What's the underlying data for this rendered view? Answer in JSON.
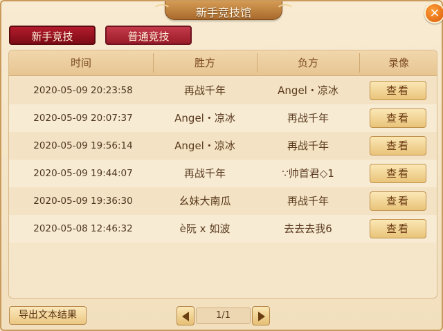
{
  "window": {
    "title": "新手竞技馆",
    "close_icon": "×"
  },
  "tabs": [
    {
      "label": "新手竞技",
      "active": true
    },
    {
      "label": "普通竞技",
      "active": false
    }
  ],
  "table": {
    "headers": [
      "时间",
      "胜方",
      "负方",
      "录像"
    ],
    "rows": [
      {
        "time": "2020-05-09 20:23:58",
        "winner": "再战千年",
        "loser": "Angel・凉冰",
        "action": "查看"
      },
      {
        "time": "2020-05-09 20:07:37",
        "winner": "Angel・凉冰",
        "loser": "再战千年",
        "action": "查看"
      },
      {
        "time": "2020-05-09 19:56:14",
        "winner": "Angel・凉冰",
        "loser": "再战千年",
        "action": "查看"
      },
      {
        "time": "2020-05-09 19:44:07",
        "winner": "再战千年",
        "loser": "∵帅首君◇1",
        "action": "查看"
      },
      {
        "time": "2020-05-09 19:36:30",
        "winner": "幺妹大南瓜",
        "loser": "再战千年",
        "action": "查看"
      },
      {
        "time": "2020-05-08 12:46:32",
        "winner": "è阮 x 如波",
        "loser": "去去去我6",
        "action": "查看"
      }
    ]
  },
  "footer": {
    "export_label": "导出文本结果",
    "page_label": "1/1"
  }
}
